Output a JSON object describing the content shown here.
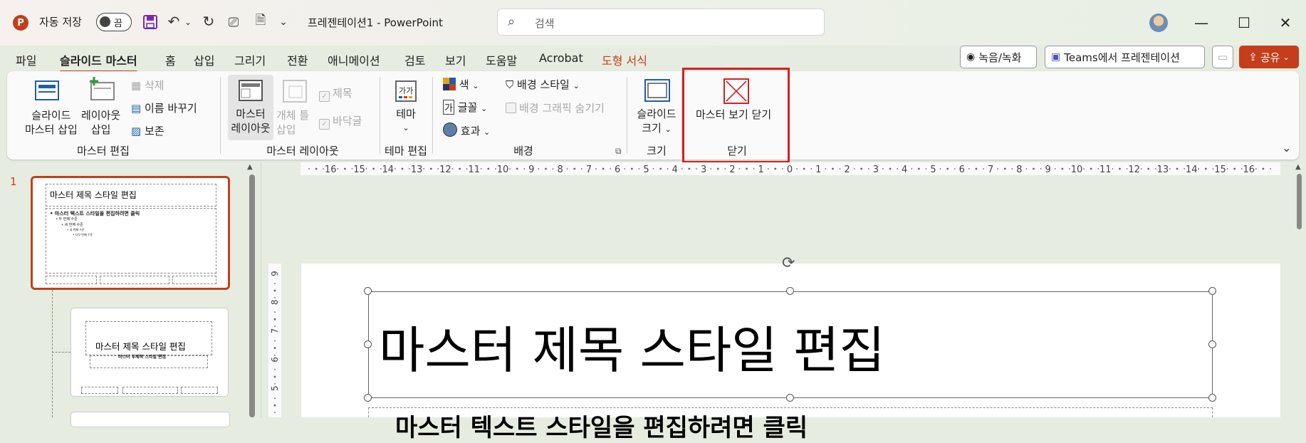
{
  "titlebar": {
    "app_icon": "P",
    "autosave_label": "자동 저장",
    "autosave_state": "끔",
    "doc_title": "프레젠테이션1  -  PowerPoint",
    "search_placeholder": "검색"
  },
  "menu_tabs": [
    "파일",
    "슬라이드 마스터",
    "홈",
    "삽입",
    "그리기",
    "전환",
    "애니메이션",
    "검토",
    "보기",
    "도움말",
    "Acrobat",
    "도형 서식"
  ],
  "header_buttons": {
    "record": "녹음/녹화",
    "teams": "Teams에서 프레젠테이션",
    "share": "공유"
  },
  "ribbon": {
    "master_edit": {
      "insert_master": [
        "슬라이드",
        "마스터 삽입"
      ],
      "insert_layout": [
        "레이아웃",
        "삽입"
      ],
      "delete": "삭제",
      "rename": "이름 바꾸기",
      "preserve": "보존",
      "label": "마스터 편집"
    },
    "master_layout": {
      "master_layout_btn": [
        "마스터",
        "레이아웃"
      ],
      "insert_placeholder": [
        "개체 틀",
        "삽입"
      ],
      "title_chk": "제목",
      "footer_chk": "바닥글",
      "label": "마스터 레이아웃"
    },
    "theme_edit": {
      "theme_btn": "테마",
      "label": "테마 편집"
    },
    "background": {
      "colors": "색",
      "fonts": "글꼴",
      "effects": "효과",
      "bg_styles": "배경 스타일",
      "hide_bg": "배경 그래픽 숨기기",
      "label": "배경"
    },
    "size": {
      "slide_size": [
        "슬라이드",
        "크기"
      ],
      "label": "크기"
    },
    "close": {
      "close_master": "마스터 보기 닫기",
      "label": "닫기"
    }
  },
  "thumbnails": {
    "slide_number": "1",
    "thumb1_title": "마스터 제목 스타일 편집",
    "thumb1_body": "• 마스터 텍스트 스타일을 편집하려면 클릭",
    "thumb1_lvl2": "• 두 번째 수준",
    "thumb1_lvl3": "• 세 번째 수준",
    "thumb1_lvl4": "• 네 번째 수준",
    "thumb1_lvl5": "• 다섯 번째 수준",
    "thumb2_title": "마스터 제목 스타일 편집",
    "thumb2_sub": "마스터 부제목 스타일 편집"
  },
  "ruler_numbers": [
    "16",
    "15",
    "14",
    "13",
    "12",
    "11",
    "10",
    "9",
    "8",
    "7",
    "6",
    "5",
    "4",
    "3",
    "2",
    "1",
    "0",
    "1",
    "2",
    "3",
    "4",
    "5",
    "6",
    "7",
    "8",
    "9",
    "10",
    "11",
    "12",
    "13",
    "14",
    "15",
    "16"
  ],
  "vruler_numbers": [
    "9",
    "8",
    "7",
    "6",
    "5"
  ],
  "slide": {
    "title": "마스터 제목 스타일 편집",
    "body": "마스터 텍스트 스타일을 편집하려면 클릭"
  }
}
